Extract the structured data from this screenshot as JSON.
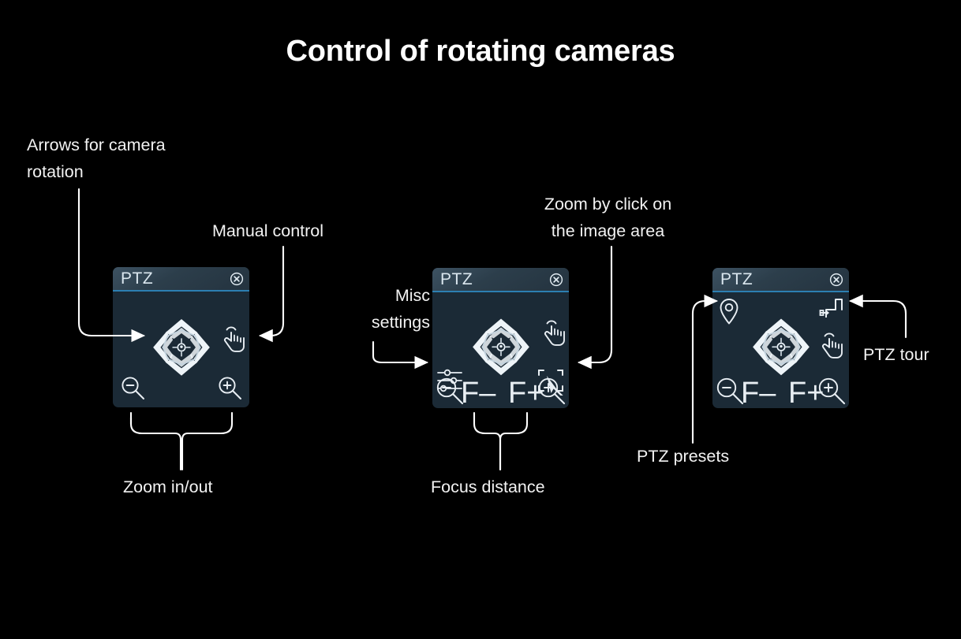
{
  "page": {
    "title": "Control of rotating cameras",
    "background": "#000000"
  },
  "theme": {
    "panel_bg": "#1b2a36",
    "panel_header_bg": "#2c3e4b",
    "accent_underline": "#2c7fb2",
    "icon_color": "#e8eef3",
    "label_color": "#f2f2f2"
  },
  "annotations": [
    {
      "id": "arrows",
      "text": "Arrows for camera\nrotation",
      "name": "annotation-arrows-for-camera-rotation"
    },
    {
      "id": "manual",
      "text": "Manual control",
      "name": "annotation-manual-control"
    },
    {
      "id": "zoomclick",
      "text": "Zoom by click on\nthe image area",
      "name": "annotation-zoom-by-click"
    },
    {
      "id": "misc",
      "text": "Misc\nsettings",
      "name": "annotation-misc-settings"
    },
    {
      "id": "zoominout",
      "text": "Zoom in/out",
      "name": "annotation-zoom-in-out"
    },
    {
      "id": "focus",
      "text": "Focus distance",
      "name": "annotation-focus-distance"
    },
    {
      "id": "presets",
      "text": "PTZ presets",
      "name": "annotation-ptz-presets"
    },
    {
      "id": "tour",
      "text": "PTZ tour",
      "name": "annotation-ptz-tour"
    }
  ],
  "panels": [
    {
      "id": "panel-basic",
      "title": "PTZ",
      "close_icon": "close-circle-icon",
      "controls": [
        {
          "icon": "ptz-joystick-icon",
          "label": ""
        },
        {
          "icon": "hand-pointer-icon",
          "label": ""
        },
        {
          "icon": "zoom-out-icon",
          "label": ""
        },
        {
          "icon": "zoom-in-icon",
          "label": ""
        }
      ]
    },
    {
      "id": "panel-focus",
      "title": "PTZ",
      "close_icon": "close-circle-icon",
      "controls": [
        {
          "icon": "ptz-joystick-icon",
          "label": ""
        },
        {
          "icon": "hand-pointer-icon",
          "label": ""
        },
        {
          "icon": "sliders-icon",
          "label": ""
        },
        {
          "icon": "select-area-zoom-icon",
          "label": ""
        },
        {
          "icon": "zoom-out-icon",
          "label": ""
        },
        {
          "icon": "focus-near-label",
          "label": "F–"
        },
        {
          "icon": "focus-far-label",
          "label": "F+"
        },
        {
          "icon": "zoom-in-icon",
          "label": ""
        }
      ]
    },
    {
      "id": "panel-presets",
      "title": "PTZ",
      "close_icon": "close-circle-icon",
      "controls": [
        {
          "icon": "map-pin-icon",
          "label": ""
        },
        {
          "icon": "ptz-tour-icon",
          "label": ""
        },
        {
          "icon": "ptz-joystick-icon",
          "label": ""
        },
        {
          "icon": "hand-pointer-icon",
          "label": ""
        },
        {
          "icon": "zoom-out-icon",
          "label": ""
        },
        {
          "icon": "focus-near-label",
          "label": "F–"
        },
        {
          "icon": "focus-far-label",
          "label": "F+"
        },
        {
          "icon": "zoom-in-icon",
          "label": ""
        }
      ]
    }
  ]
}
